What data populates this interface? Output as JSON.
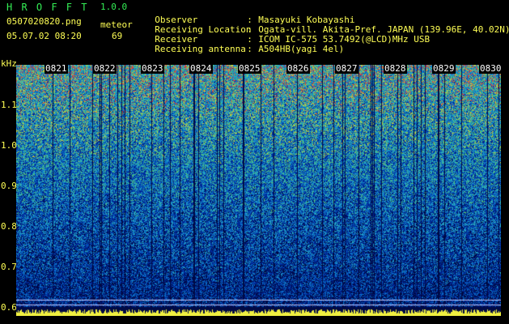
{
  "app": {
    "title": "H R O F F T",
    "version": "1.0.0",
    "filename": "0507020820.png",
    "datetime": "05.07.02 08:20",
    "meteor_label": "meteor",
    "meteor_count": "69"
  },
  "info": [
    {
      "key": "Observer",
      "value": "Masayuki Kobayashi"
    },
    {
      "key": "Receiving Location",
      "value": "Ogata-vill. Akita-Pref. JAPAN (139.96E, 40.02N)"
    },
    {
      "key": "Receiver",
      "value": "ICOM IC-575 53.7492(@LCD)MHz USB"
    },
    {
      "key": "Receiving antenna",
      "value": "A504HB(yagi 4el)"
    }
  ],
  "axis": {
    "y_unit": "kHz",
    "y_ticks": [
      "1.1",
      "1.0",
      "0.9",
      "0.8",
      "0.7",
      "0.6"
    ],
    "x_ticks": [
      "0821",
      "0822",
      "0823",
      "0824",
      "0825",
      "0826",
      "0827",
      "0828",
      "0829",
      "0830"
    ]
  },
  "colors": {
    "background": "#000000",
    "text_yellow": "#ffff55",
    "text_green": "#33ee55",
    "signal_low": "#001a66",
    "signal_mid": "#2a8fd0",
    "signal_high": "#e04040"
  }
}
